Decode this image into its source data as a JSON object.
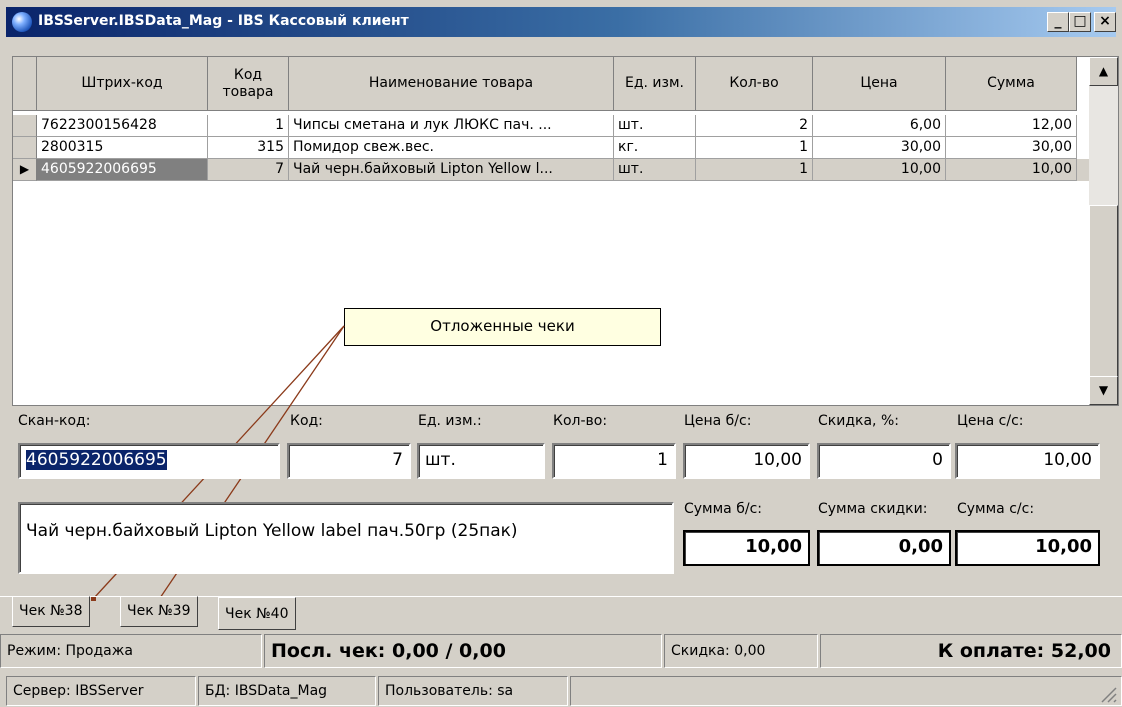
{
  "window": {
    "title": "IBSServer.IBSData_Mag - IBS Кассовый клиент",
    "min": "_",
    "max": "□",
    "close": "×"
  },
  "grid": {
    "columns": [
      "Штрих-код",
      "Код товара",
      "Наименование товара",
      "Ед. изм.",
      "Кол-во",
      "Цена",
      "Сумма"
    ],
    "rows": [
      {
        "barcode": "7622300156428",
        "code": "1",
        "name": "Чипсы сметана и лук ЛЮКС пач. ...",
        "unit": "шт.",
        "qty": "2",
        "price": "6,00",
        "sum": "12,00"
      },
      {
        "barcode": "2800315",
        "code": "315",
        "name": "Помидор свеж.вес.",
        "unit": "кг.",
        "qty": "1",
        "price": "30,00",
        "sum": "30,00"
      },
      {
        "barcode": "4605922006695",
        "code": "7",
        "name": "Чай черн.байховый Lipton Yellow l...",
        "unit": "шт.",
        "qty": "1",
        "price": "10,00",
        "sum": "10,00"
      }
    ]
  },
  "callout": "Отложенные чеки",
  "form": {
    "scan_label": "Скан-код:",
    "scan_value": "4605922006695",
    "code_label": "Код:",
    "code_value": "7",
    "unit_label": "Ед. изм.:",
    "unit_value": "шт.",
    "qty_label": "Кол-во:",
    "qty_value": "1",
    "price_label": "Цена б/с:",
    "price_value": "10,00",
    "disc_label": "Скидка, %:",
    "disc_value": "0",
    "pricedisc_label": "Цена с/с:",
    "pricedisc_value": "10,00",
    "description": "Чай черн.байховый Lipton Yellow label пач.50гр (25пак)",
    "sum_label": "Сумма б/с:",
    "sum_value": "10,00",
    "sumdisc_label": "Сумма скидки:",
    "sumdisc_value": "0,00",
    "total_label": "Сумма с/с:",
    "total_value": "10,00"
  },
  "tabs": [
    "Чек №38",
    "Чек №39",
    "Чек №40"
  ],
  "status": {
    "mode": "Режим: Продажа",
    "last": "Посл. чек: 0,00 / 0,00",
    "discount": "Скидка: 0,00",
    "pay": "К оплате: 52,00",
    "server": "Сервер: IBSServer",
    "db": "БД: IBSData_Mag",
    "user": "Пользователь: sa"
  },
  "colors": {
    "title_start": "#0a246a",
    "selection": "#0a246a",
    "callout_line": "#8b3a1a",
    "callout_bg": "#ffffe1"
  }
}
